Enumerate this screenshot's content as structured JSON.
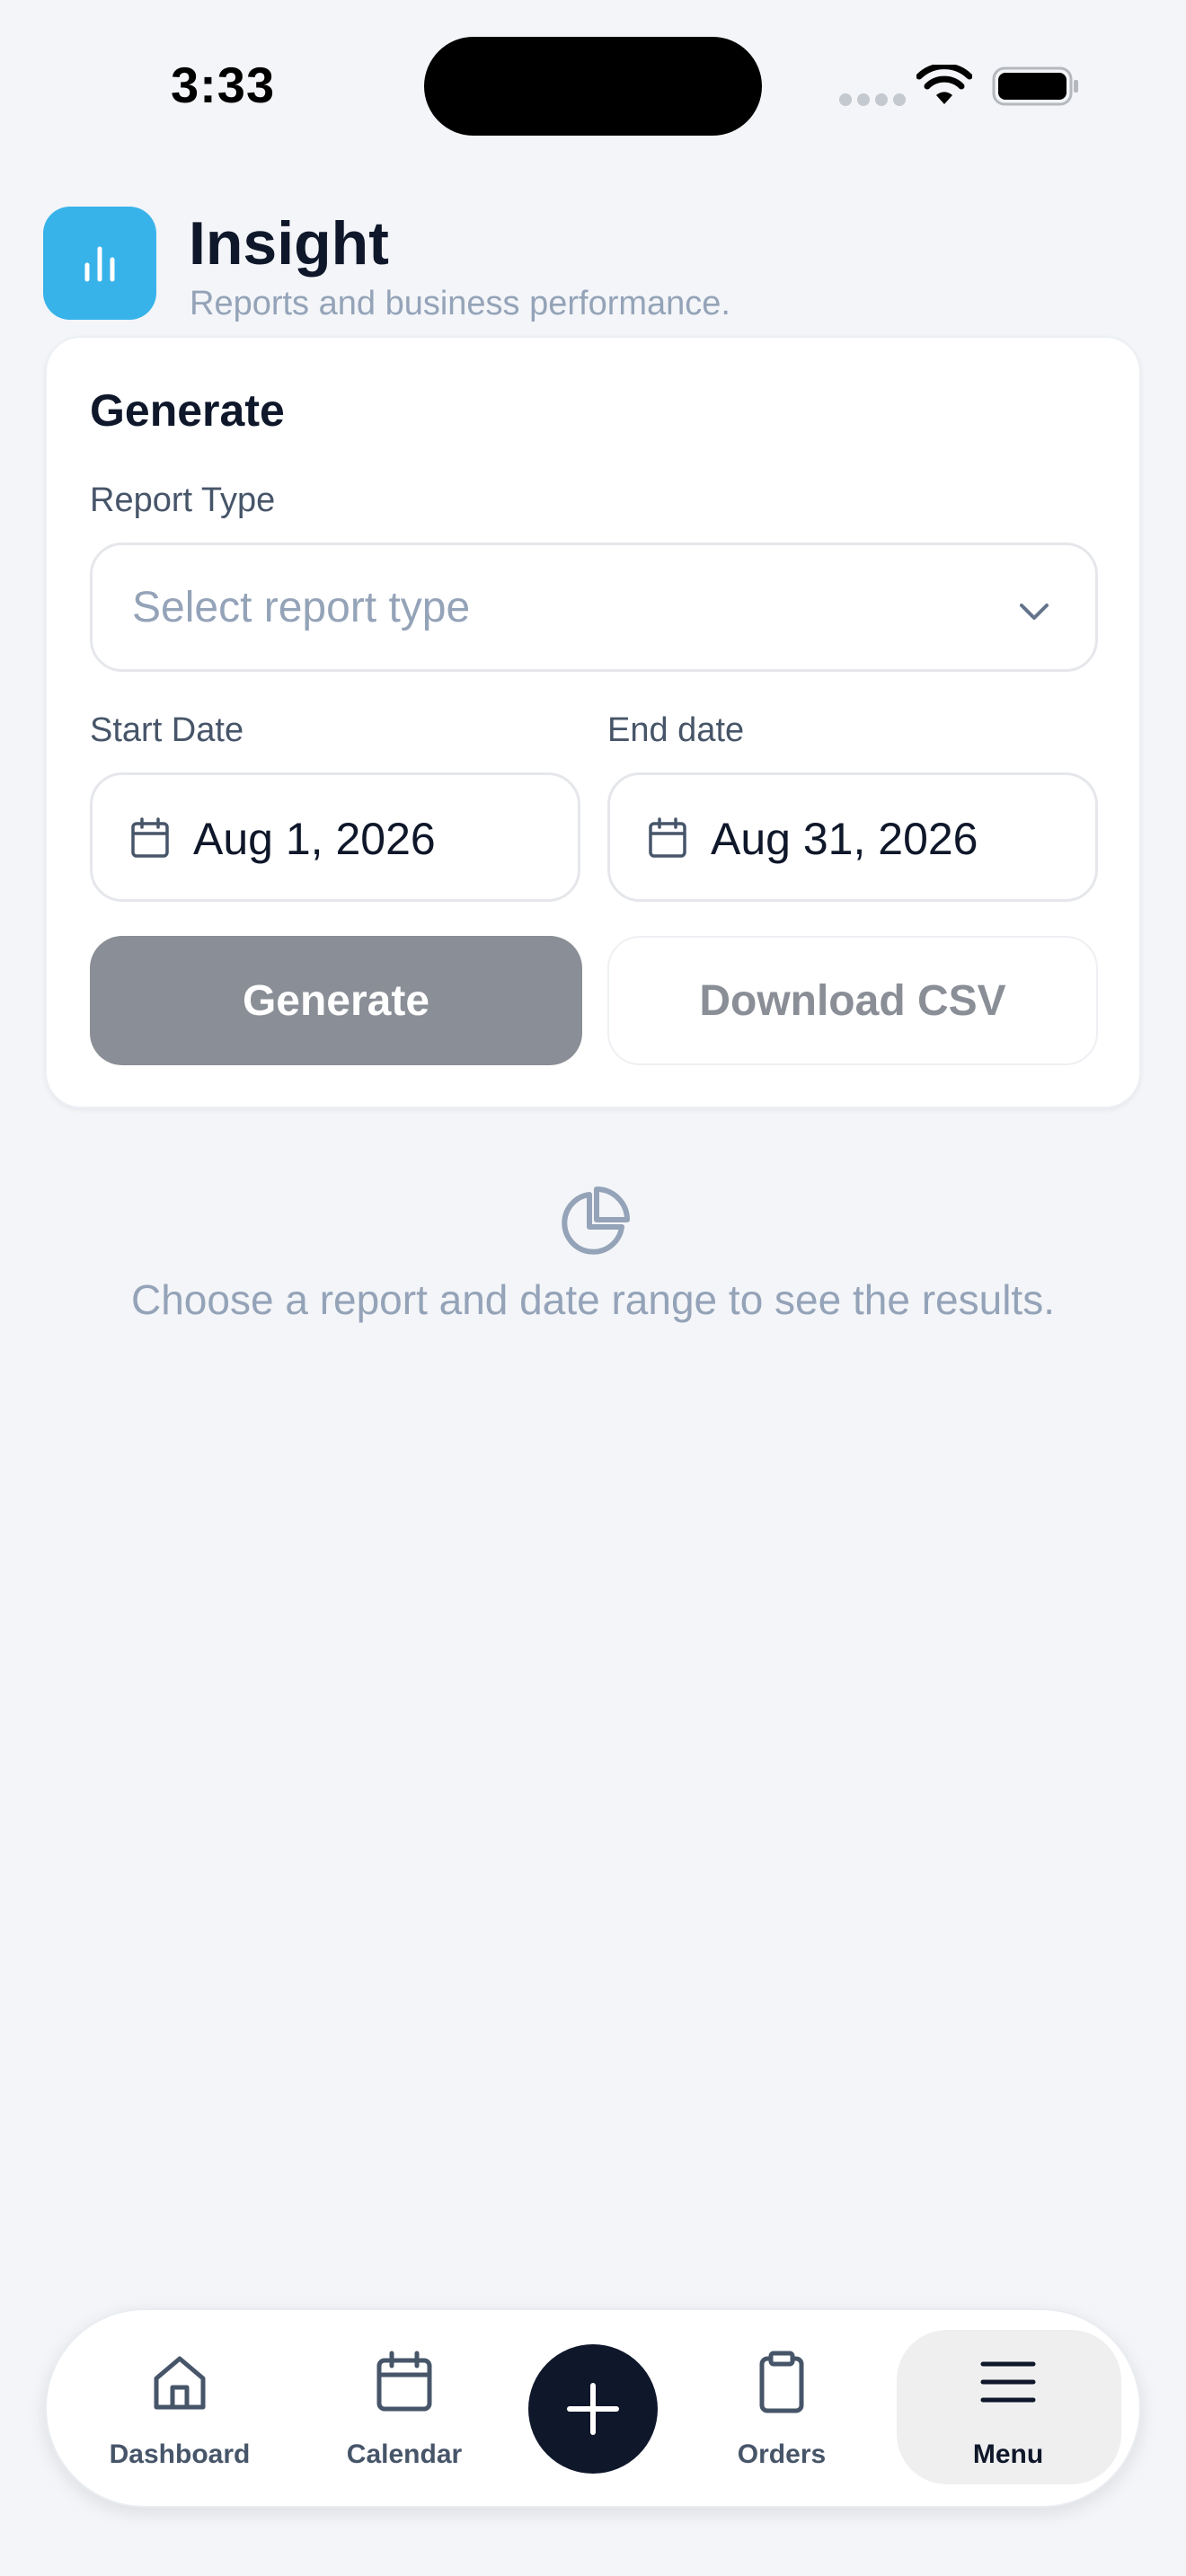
{
  "status_bar": {
    "time": "3:33"
  },
  "header": {
    "title": "Insight",
    "subtitle": "Reports and business performance.",
    "logo_color": "#38b3ea"
  },
  "generate_card": {
    "title": "Generate",
    "report_type": {
      "label": "Report Type",
      "placeholder": "Select report type",
      "value": ""
    },
    "start_date": {
      "label": "Start Date",
      "value": "Aug 1, 2026"
    },
    "end_date": {
      "label": "End date",
      "value": "Aug 31, 2026"
    },
    "generate_button": "Generate",
    "download_button": "Download CSV"
  },
  "empty_state": {
    "icon": "pie-chart-icon",
    "message": "Choose a report and date range to see the results."
  },
  "tab_bar": {
    "items": [
      {
        "label": "Dashboard",
        "icon": "home-icon"
      },
      {
        "label": "Calendar",
        "icon": "calendar-icon"
      },
      {
        "label": "Orders",
        "icon": "clipboard-icon"
      },
      {
        "label": "Menu",
        "icon": "menu-icon",
        "active": true
      }
    ],
    "fab_icon": "plus-icon"
  }
}
